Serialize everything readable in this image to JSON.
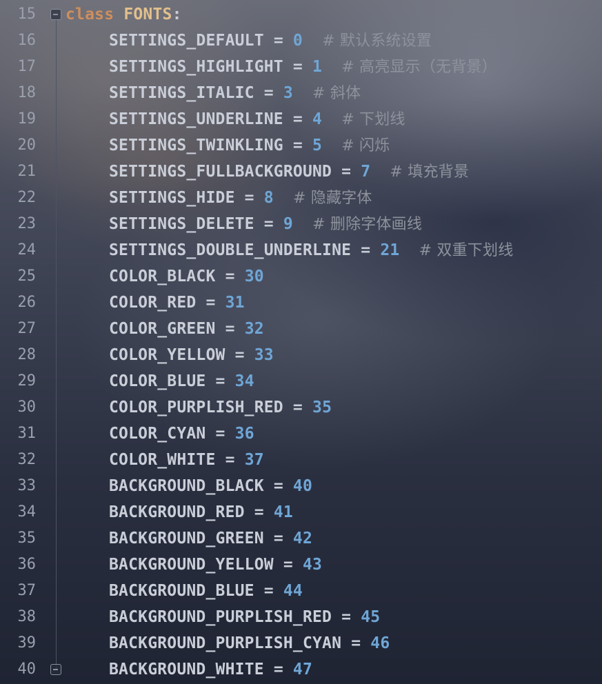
{
  "editor": {
    "colors": {
      "keyword": "#cf8e5d",
      "class_name": "#e2c08d",
      "identifier": "#c9ced8",
      "number": "#6fa6d6",
      "comment": "#8d929c",
      "line_number": "#9aa0ad"
    },
    "header": {
      "line_number": "15",
      "keyword": "class",
      "class_name": "FONTS",
      "colon": ":"
    },
    "lines": [
      {
        "n": "16",
        "name": "SETTINGS_DEFAULT",
        "value": "0",
        "comment": "# 默认系统设置"
      },
      {
        "n": "17",
        "name": "SETTINGS_HIGHLIGHT",
        "value": "1",
        "comment": "# 高亮显示（无背景）"
      },
      {
        "n": "18",
        "name": "SETTINGS_ITALIC",
        "value": "3",
        "comment": "# 斜体"
      },
      {
        "n": "19",
        "name": "SETTINGS_UNDERLINE",
        "value": "4",
        "comment": "# 下划线"
      },
      {
        "n": "20",
        "name": "SETTINGS_TWINKLING",
        "value": "5",
        "comment": "# 闪烁"
      },
      {
        "n": "21",
        "name": "SETTINGS_FULLBACKGROUND",
        "value": "7",
        "comment": "# 填充背景"
      },
      {
        "n": "22",
        "name": "SETTINGS_HIDE",
        "value": "8",
        "comment": "# 隐藏字体"
      },
      {
        "n": "23",
        "name": "SETTINGS_DELETE",
        "value": "9",
        "comment": "# 删除字体画线"
      },
      {
        "n": "24",
        "name": "SETTINGS_DOUBLE_UNDERLINE",
        "value": "21",
        "comment": "# 双重下划线"
      },
      {
        "n": "25",
        "name": "COLOR_BLACK",
        "value": "30",
        "comment": ""
      },
      {
        "n": "26",
        "name": "COLOR_RED",
        "value": "31",
        "comment": ""
      },
      {
        "n": "27",
        "name": "COLOR_GREEN",
        "value": "32",
        "comment": ""
      },
      {
        "n": "28",
        "name": "COLOR_YELLOW",
        "value": "33",
        "comment": ""
      },
      {
        "n": "29",
        "name": "COLOR_BLUE",
        "value": "34",
        "comment": ""
      },
      {
        "n": "30",
        "name": "COLOR_PURPLISH_RED",
        "value": "35",
        "comment": ""
      },
      {
        "n": "31",
        "name": "COLOR_CYAN",
        "value": "36",
        "comment": ""
      },
      {
        "n": "32",
        "name": "COLOR_WHITE",
        "value": "37",
        "comment": ""
      },
      {
        "n": "33",
        "name": "BACKGROUND_BLACK",
        "value": "40",
        "comment": ""
      },
      {
        "n": "34",
        "name": "BACKGROUND_RED",
        "value": "41",
        "comment": ""
      },
      {
        "n": "35",
        "name": "BACKGROUND_GREEN",
        "value": "42",
        "comment": ""
      },
      {
        "n": "36",
        "name": "BACKGROUND_YELLOW",
        "value": "43",
        "comment": ""
      },
      {
        "n": "37",
        "name": "BACKGROUND_BLUE",
        "value": "44",
        "comment": ""
      },
      {
        "n": "38",
        "name": "BACKGROUND_PURPLISH_RED",
        "value": "45",
        "comment": ""
      },
      {
        "n": "39",
        "name": "BACKGROUND_PURPLISH_CYAN",
        "value": "46",
        "comment": ""
      },
      {
        "n": "40",
        "name": "BACKGROUND_WHITE",
        "value": "47",
        "comment": ""
      }
    ],
    "fold_icons": [
      "fold-collapse-icon",
      "fold-end-icon"
    ]
  }
}
